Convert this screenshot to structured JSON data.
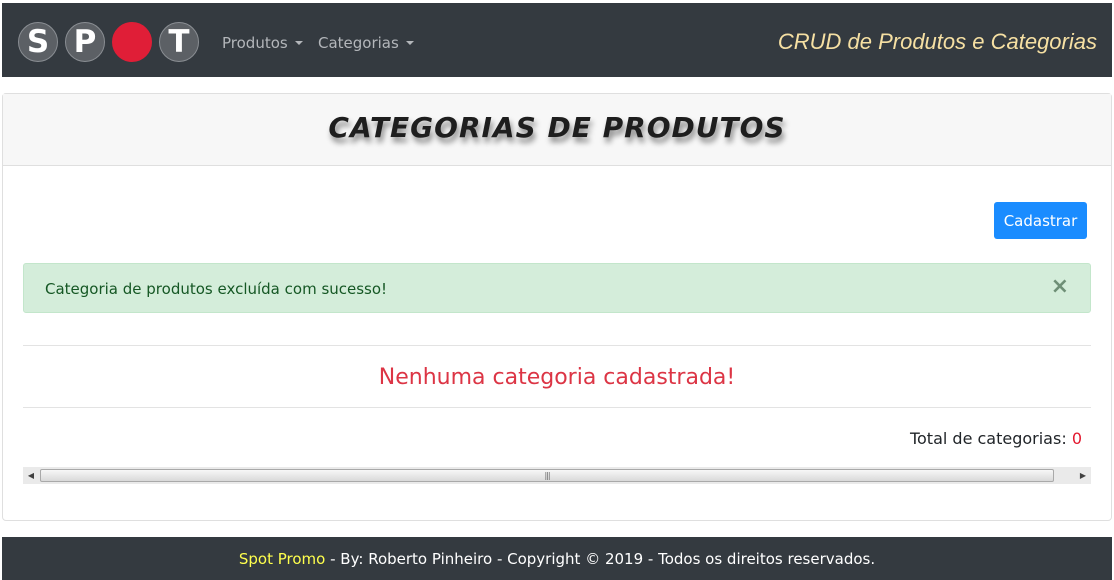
{
  "navbar": {
    "logo_letters": [
      "S",
      "P",
      "T"
    ],
    "menu": [
      {
        "label": "Produtos"
      },
      {
        "label": "Categorias"
      }
    ],
    "brand_right": "CRUD de Produtos e Categorias",
    "colors": {
      "background": "#343a40",
      "logo_dot": "#e01e37",
      "brand_right": "#f6e0a3"
    }
  },
  "main": {
    "title": "CATEGORIAS DE PRODUTOS",
    "add_button": "Cadastrar",
    "alert": {
      "message": "Categoria de produtos excluída com sucesso!",
      "close_symbol": "×"
    },
    "empty_message": "Nenhuma categoria cadastrada!",
    "total_label": "Total de categorias:",
    "total_count": "0",
    "scrollbar": {
      "left_arrow": "◀",
      "right_arrow": "▶",
      "grip": "|||"
    }
  },
  "footer": {
    "brand": "Spot Promo",
    "text": " - By: Roberto Pinheiro - Copyright © 2019 - Todos os direitos reservados.",
    "colors": {
      "brand": "#ffff4d"
    }
  },
  "icons": [
    "caret-down-icon",
    "close-icon",
    "scroll-left-icon",
    "scroll-right-icon"
  ]
}
